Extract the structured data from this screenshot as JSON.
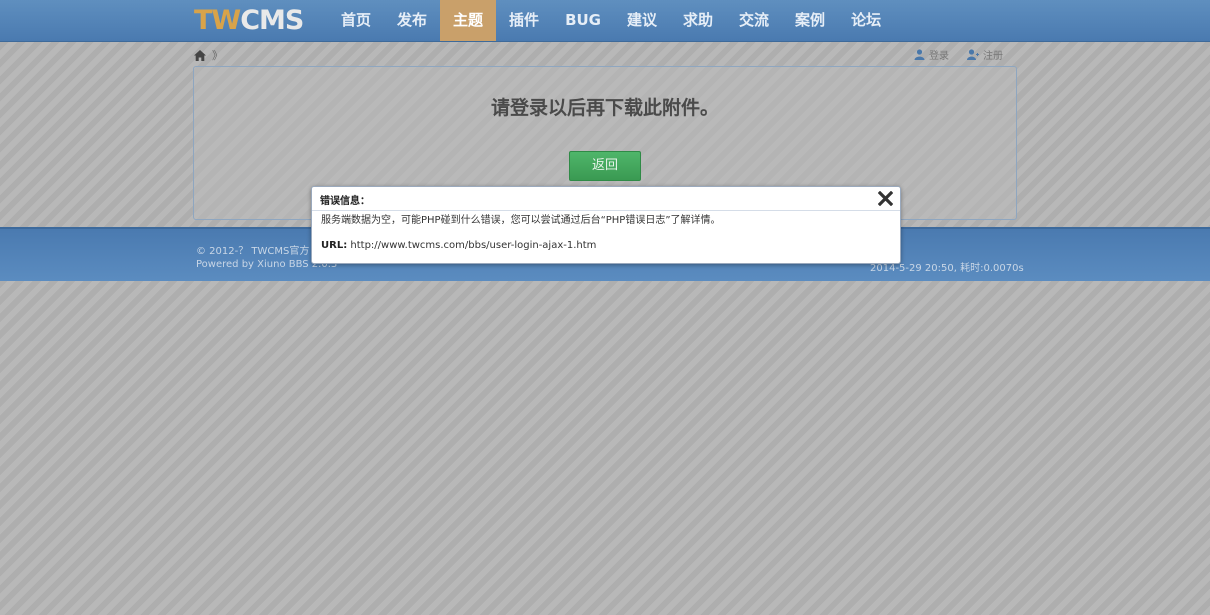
{
  "header": {
    "logo_part1": "TW",
    "logo_part2": "CMS",
    "nav": [
      {
        "label": "首页",
        "active": false
      },
      {
        "label": "发布",
        "active": false
      },
      {
        "label": "主题",
        "active": true
      },
      {
        "label": "插件",
        "active": false
      },
      {
        "label": "BUG",
        "active": false
      },
      {
        "label": "建议",
        "active": false
      },
      {
        "label": "求助",
        "active": false
      },
      {
        "label": "交流",
        "active": false
      },
      {
        "label": "案例",
        "active": false
      },
      {
        "label": "论坛",
        "active": false
      }
    ]
  },
  "breadcrumb": {
    "home_icon": "home-icon",
    "separator": "》"
  },
  "user_links": {
    "login": "登录",
    "register": "注册"
  },
  "main": {
    "message": "请登录以后再下载此附件。",
    "back_button": "返回"
  },
  "footer": {
    "copyright": "© 2012-？ TWCMS官方",
    "powered": "Powered by Xiuno BBS 2.0.3",
    "stats": "2014-5-29 20:50, 耗时:0.0070s"
  },
  "dialog": {
    "title": "错误信息：",
    "body": "服务端数据为空，可能PHP碰到什么错误，您可以尝试通过后台“PHP错误日志”了解详情。",
    "url_label": "URL:",
    "url_value": "http://www.twcms.com/bbs/user-login-ajax-1.htm"
  },
  "colors": {
    "nav_bg": "#4a7ab0",
    "nav_active": "#c9a06a",
    "button_green": "#3a9a52"
  }
}
